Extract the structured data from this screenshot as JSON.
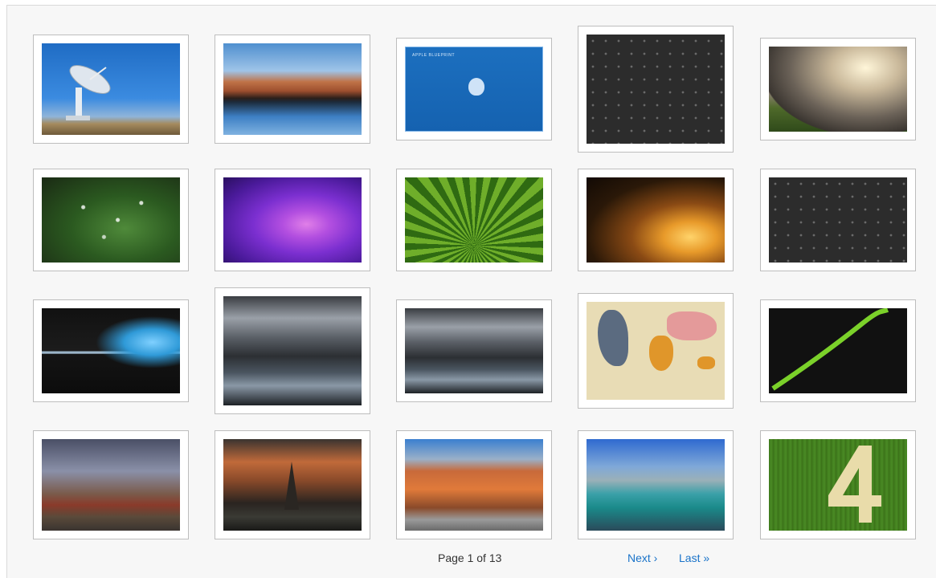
{
  "gallery": {
    "thumbnails": [
      {
        "subject": "radio-telescope"
      },
      {
        "subject": "desert-canyon-reflection"
      },
      {
        "subject": "blueprint-apple-logo"
      },
      {
        "subject": "dark-icon-grid"
      },
      {
        "subject": "cloudy-field-tree"
      },
      {
        "subject": "leaf-water-drops"
      },
      {
        "subject": "purple-swirl"
      },
      {
        "subject": "green-palm-frond"
      },
      {
        "subject": "tree-sunset"
      },
      {
        "subject": "dark-icon-grid"
      },
      {
        "subject": "blue-paint-splash"
      },
      {
        "subject": "mountain-lake-hdr"
      },
      {
        "subject": "mountain-lake-hdr"
      },
      {
        "subject": "vintage-world-map"
      },
      {
        "subject": "green-ribbon-dark"
      },
      {
        "subject": "rusty-boat-hdr"
      },
      {
        "subject": "temple-sunset"
      },
      {
        "subject": "building-arcade-hdr"
      },
      {
        "subject": "harbor-hdr"
      },
      {
        "subject": "green-number-four"
      }
    ]
  },
  "blueprint": {
    "heading": "APPLE BLUEPRINT"
  },
  "pagination": {
    "page_label": "Page 1 of 13",
    "next_label": "Next ›",
    "last_label": "Last »"
  }
}
